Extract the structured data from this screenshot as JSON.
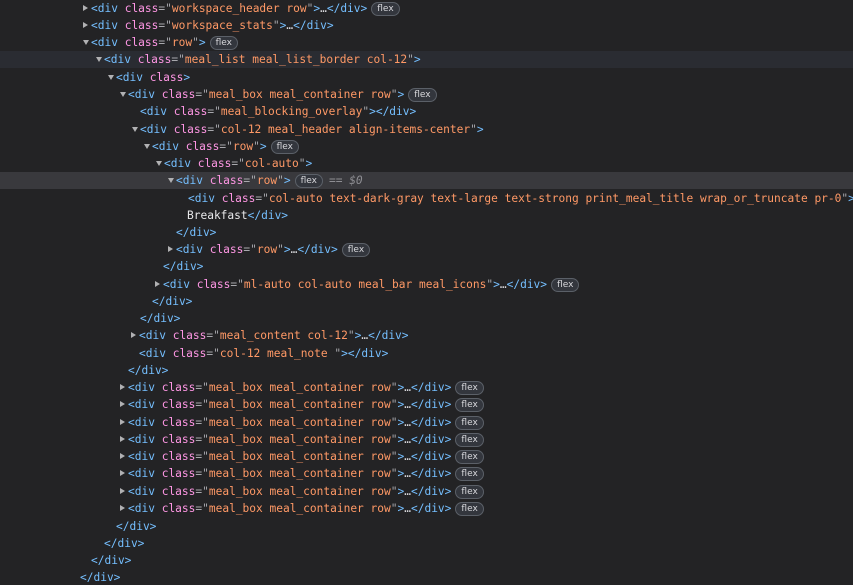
{
  "rows": [
    {
      "kind": "open",
      "twisty": "closed",
      "attr": "class",
      "value": "workspace_header row",
      "collapsed": true,
      "badge": "flex"
    },
    {
      "kind": "open",
      "twisty": "closed",
      "attr": "class",
      "value": "workspace_stats",
      "collapsed": true
    },
    {
      "kind": "open",
      "twisty": "open",
      "attr": "class",
      "value": "row",
      "badge": "flex"
    },
    {
      "kind": "open",
      "twisty": "open",
      "attr": "class",
      "value": "meal_list meal_list_border col-12",
      "state": "selected-light"
    },
    {
      "kind": "open",
      "twisty": "open",
      "attr": "class",
      "bare": true
    },
    {
      "kind": "open",
      "twisty": "open",
      "attr": "class",
      "value": "meal_box meal_container row",
      "badge": "flex"
    },
    {
      "kind": "open",
      "attr": "class",
      "value": "meal_blocking_overlay",
      "empty": true
    },
    {
      "kind": "open",
      "twisty": "open",
      "attr": "class",
      "value": "col-12 meal_header align-items-center"
    },
    {
      "kind": "open",
      "twisty": "open",
      "attr": "class",
      "value": "row",
      "badge": "flex"
    },
    {
      "kind": "open",
      "twisty": "open",
      "attr": "class",
      "value": "col-auto"
    },
    {
      "kind": "open",
      "twisty": "open",
      "attr": "class",
      "value": "row",
      "badge": "flex",
      "state": "highlighted",
      "eq": "== ",
      "eqvar": "$0"
    },
    {
      "kind": "open",
      "attr": "class",
      "value": "col-auto text-dark-gray text-large text-strong print_meal_title wrap_or_truncate pr-0"
    },
    {
      "kind": "textclose",
      "text": "Breakfast"
    },
    {
      "kind": "close"
    },
    {
      "kind": "open",
      "twisty": "closed",
      "attr": "class",
      "value": "row",
      "collapsed": true,
      "badge": "flex"
    },
    {
      "kind": "close"
    },
    {
      "kind": "open",
      "twisty": "closed",
      "attr": "class",
      "value": "ml-auto col-auto meal_bar meal_icons",
      "collapsed": true,
      "badge": "flex"
    },
    {
      "kind": "close"
    },
    {
      "kind": "close"
    },
    {
      "kind": "open",
      "twisty": "closed",
      "attr": "class",
      "value": "meal_content col-12",
      "collapsed": true
    },
    {
      "kind": "open",
      "attr": "class",
      "value": "col-12 meal_note ",
      "empty": true
    },
    {
      "kind": "close"
    },
    {
      "kind": "open",
      "twisty": "closed",
      "attr": "class",
      "value": "meal_box meal_container row",
      "collapsed": true,
      "badge": "flex"
    },
    {
      "kind": "open",
      "twisty": "closed",
      "attr": "class",
      "value": "meal_box meal_container row",
      "collapsed": true,
      "badge": "flex"
    },
    {
      "kind": "open",
      "twisty": "closed",
      "attr": "class",
      "value": "meal_box meal_container row",
      "collapsed": true,
      "badge": "flex"
    },
    {
      "kind": "open",
      "twisty": "closed",
      "attr": "class",
      "value": "meal_box meal_container row",
      "collapsed": true,
      "badge": "flex"
    },
    {
      "kind": "open",
      "twisty": "closed",
      "attr": "class",
      "value": "meal_box meal_container row",
      "collapsed": true,
      "badge": "flex"
    },
    {
      "kind": "open",
      "twisty": "closed",
      "attr": "class",
      "value": "meal_box meal_container row",
      "collapsed": true,
      "badge": "flex"
    },
    {
      "kind": "open",
      "twisty": "closed",
      "attr": "class",
      "value": "meal_box meal_container row",
      "collapsed": true,
      "badge": "flex"
    },
    {
      "kind": "open",
      "twisty": "closed",
      "attr": "class",
      "value": "meal_box meal_container row",
      "collapsed": true,
      "badge": "flex"
    },
    {
      "kind": "close"
    },
    {
      "kind": "close"
    },
    {
      "kind": "close"
    },
    {
      "kind": "close"
    }
  ]
}
